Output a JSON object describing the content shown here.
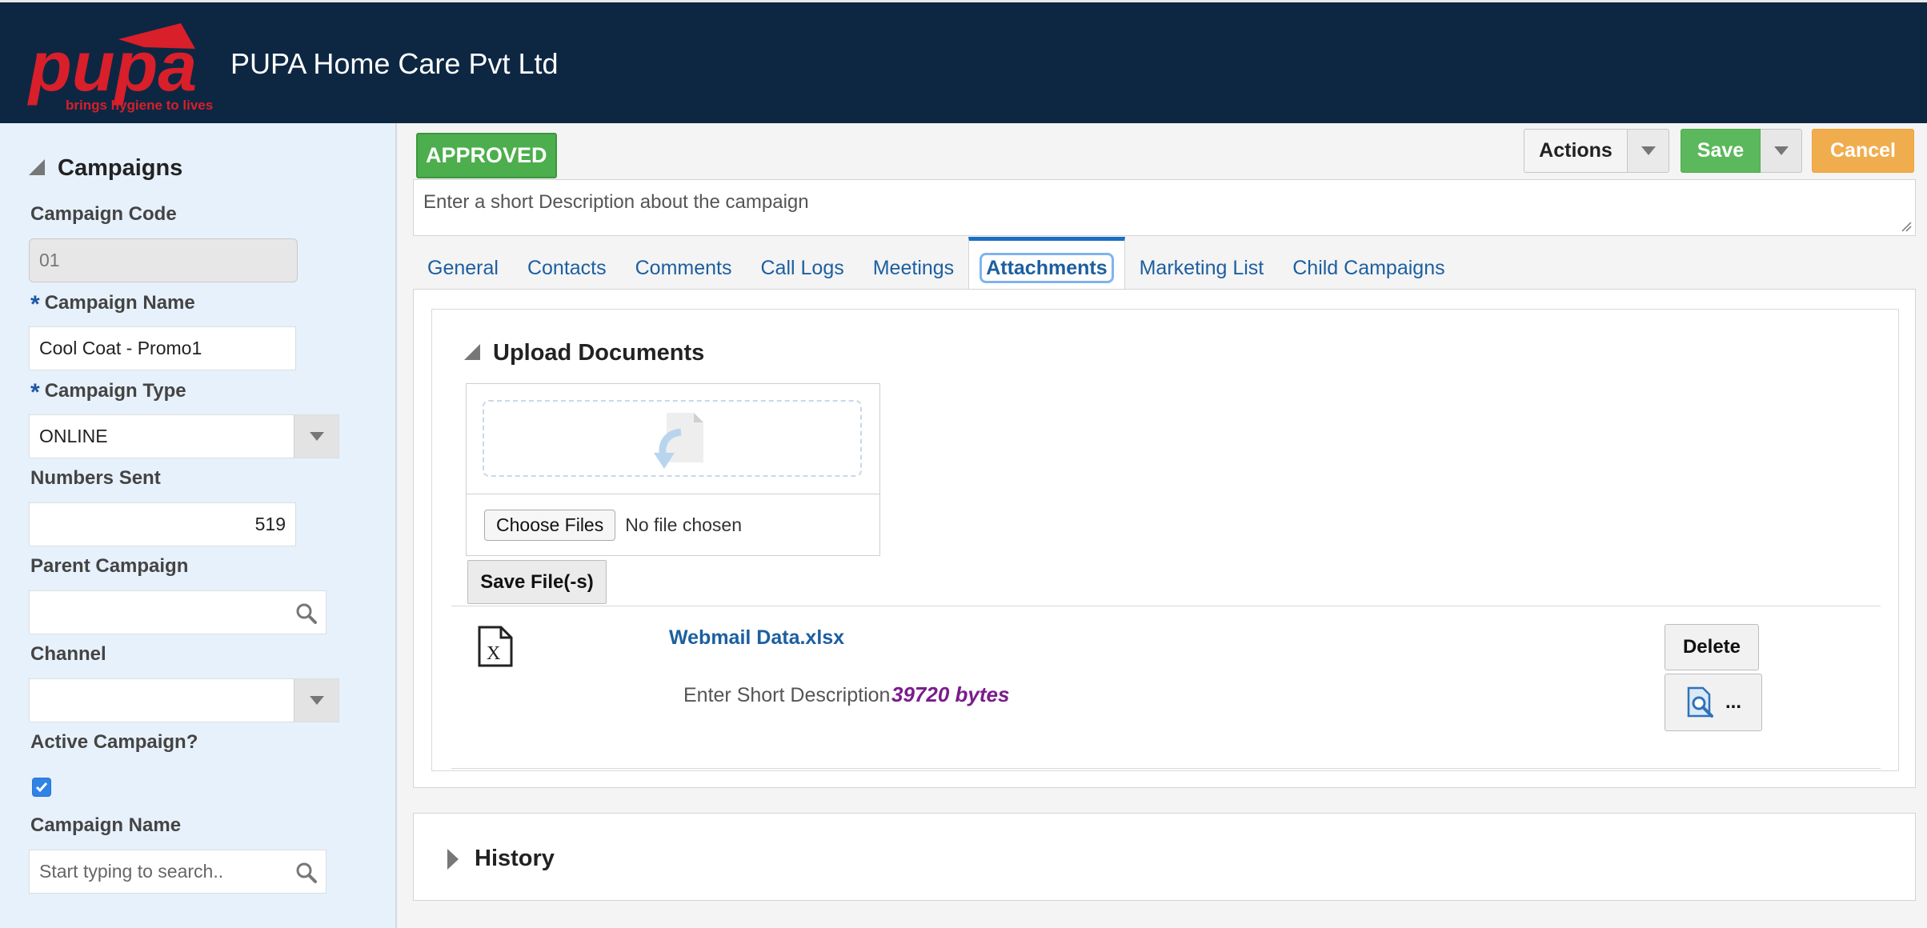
{
  "header": {
    "logo_text": "pupa",
    "logo_tagline": "brings hygiene to lives",
    "company_name": "PUPA Home Care Pvt Ltd"
  },
  "sidebar": {
    "title": "Campaigns",
    "campaign_code_label": "Campaign Code",
    "campaign_code_value": "01",
    "campaign_name_label": "Campaign Name",
    "campaign_name_value": "Cool Coat - Promo1",
    "campaign_type_label": "Campaign Type",
    "campaign_type_value": "ONLINE",
    "numbers_sent_label": "Numbers Sent",
    "numbers_sent_value": "519",
    "parent_campaign_label": "Parent Campaign",
    "parent_campaign_value": "",
    "channel_label": "Channel",
    "channel_value": "",
    "active_campaign_label": "Active Campaign?",
    "active_campaign_checked": true,
    "campaign_search_label": "Campaign Name",
    "campaign_search_placeholder": "Start typing to search..",
    "required_marker": "*"
  },
  "status": {
    "badge": "APPROVED",
    "badge_color": "#4cae4c"
  },
  "toolbar": {
    "actions_label": "Actions",
    "save_label": "Save",
    "cancel_label": "Cancel",
    "save_color": "#5cb85c",
    "cancel_color": "#f0ad4e"
  },
  "description": {
    "placeholder": "Enter a short Description about the campaign",
    "value": ""
  },
  "tabs": [
    {
      "label": "General",
      "active": false
    },
    {
      "label": "Contacts",
      "active": false
    },
    {
      "label": "Comments",
      "active": false
    },
    {
      "label": "Call Logs",
      "active": false
    },
    {
      "label": "Meetings",
      "active": false
    },
    {
      "label": "Attachments",
      "active": true
    },
    {
      "label": "Marketing List",
      "active": false
    },
    {
      "label": "Child Campaigns",
      "active": false
    }
  ],
  "upload": {
    "title": "Upload Documents",
    "choose_label": "Choose Files",
    "no_file_text": "No file chosen",
    "save_files_label": "Save File(-s)"
  },
  "attachment": {
    "file_name": "Webmail Data.xlsx",
    "description_placeholder": "Enter Short Description",
    "size": "39720 bytes",
    "delete_label": "Delete",
    "more_label": "..."
  },
  "history": {
    "title": "History"
  }
}
